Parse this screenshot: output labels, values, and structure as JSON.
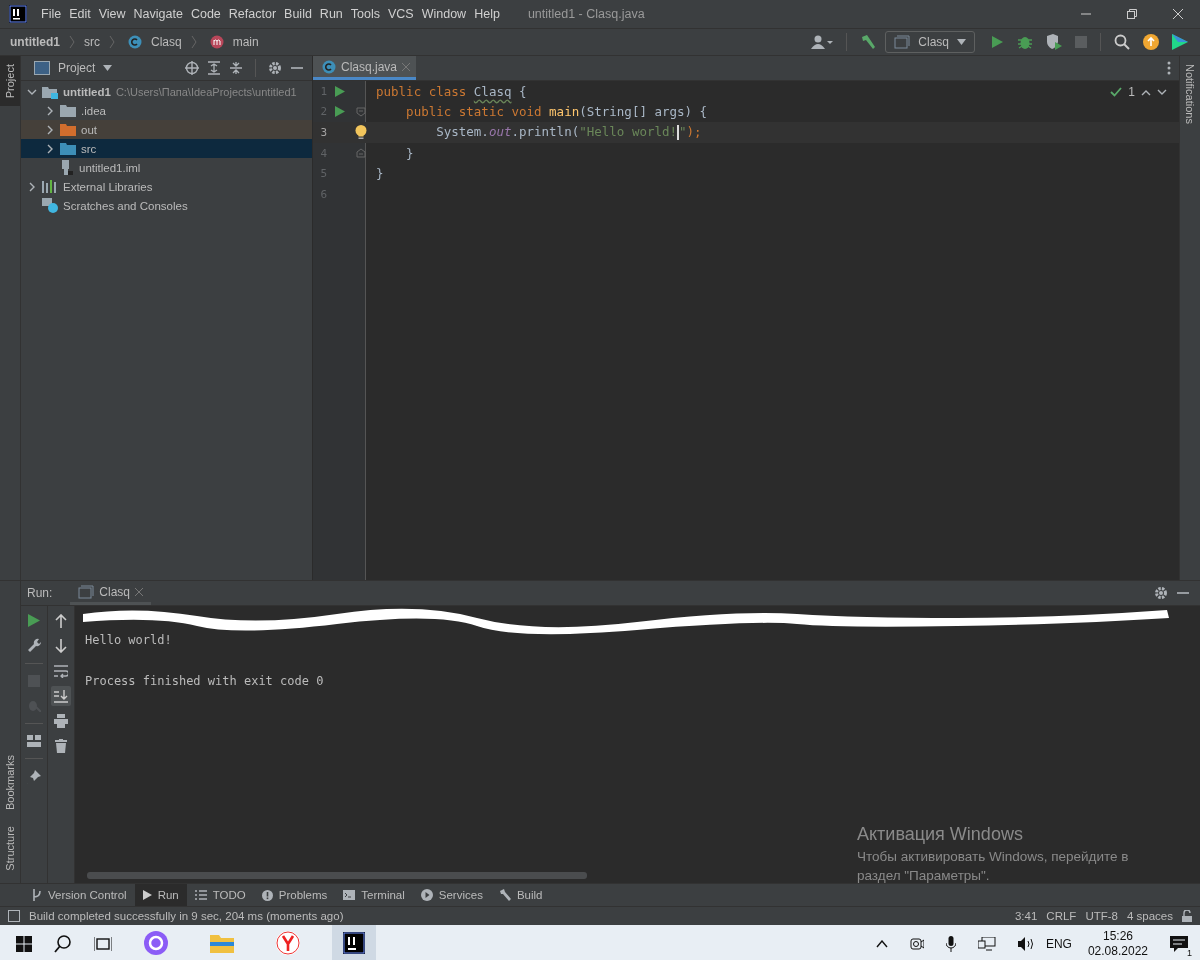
{
  "window": {
    "title": "untitled1 - Clasq.java"
  },
  "menu": [
    "File",
    "Edit",
    "View",
    "Navigate",
    "Code",
    "Refactor",
    "Build",
    "Run",
    "Tools",
    "VCS",
    "Window",
    "Help"
  ],
  "breadcrumbs": [
    {
      "label": "untitled1",
      "kind": "project"
    },
    {
      "label": "src",
      "kind": "folder"
    },
    {
      "label": "Clasq",
      "kind": "class"
    },
    {
      "label": "main",
      "kind": "method"
    }
  ],
  "run_config": {
    "label": "Clasq"
  },
  "left_strip_top": [
    {
      "label": "Project",
      "selected": true
    }
  ],
  "left_strip_bottom": [
    {
      "label": "Bookmarks",
      "selected": false
    },
    {
      "label": "Structure",
      "selected": false
    }
  ],
  "right_strip": [
    {
      "label": "Notifications",
      "selected": false
    }
  ],
  "project_panel": {
    "title": "Project",
    "tree": [
      {
        "label": "untitled1",
        "detail": "C:\\Users\\Папа\\IdeaProjects\\untitled1",
        "kind": "module",
        "expanded": true,
        "selected": false,
        "children": [
          {
            "label": ".idea",
            "kind": "folder",
            "expanded": false,
            "selected": false
          },
          {
            "label": "out",
            "kind": "excluded",
            "expanded": false,
            "selected": false
          },
          {
            "label": "src",
            "kind": "source",
            "expanded": false,
            "selected": true
          },
          {
            "label": "untitled1.iml",
            "kind": "file",
            "selected": false
          }
        ]
      },
      {
        "label": "External Libraries",
        "kind": "libraries",
        "expanded": false,
        "selected": false
      },
      {
        "label": "Scratches and Consoles",
        "kind": "scratches",
        "selected": false
      }
    ]
  },
  "editor": {
    "tabs": [
      {
        "label": "Clasq.java",
        "selected": true
      }
    ],
    "inspection": {
      "count": "1"
    },
    "lines": [
      {
        "number": "1",
        "current": false,
        "run_marker": true,
        "fold_start": false,
        "fold_end": false,
        "bulb": false,
        "tokens": [
          {
            "text": "public class ",
            "kind": "keyword",
            "caret_after": false
          },
          {
            "text": "Clasq",
            "kind": "typo",
            "caret_after": false
          },
          {
            "text": " {",
            "kind": "plain",
            "caret_after": false
          }
        ]
      },
      {
        "number": "2",
        "current": false,
        "run_marker": true,
        "fold_start": true,
        "fold_end": false,
        "bulb": false,
        "tokens": [
          {
            "text": "    public static void ",
            "kind": "keyword",
            "caret_after": false
          },
          {
            "text": "main",
            "kind": "decl",
            "caret_after": false
          },
          {
            "text": "(String[] args) {",
            "kind": "plain",
            "caret_after": false
          }
        ]
      },
      {
        "number": "3",
        "current": true,
        "run_marker": false,
        "fold_start": false,
        "fold_end": false,
        "bulb": true,
        "tokens": [
          {
            "text": "        System.",
            "kind": "plain",
            "caret_after": false
          },
          {
            "text": "out",
            "kind": "field",
            "caret_after": false
          },
          {
            "text": ".println(",
            "kind": "plain",
            "caret_after": false
          },
          {
            "text": "\"Hello world!",
            "kind": "string",
            "caret_after": true
          },
          {
            "text": "\"",
            "kind": "string",
            "caret_after": false
          },
          {
            "text": ");",
            "kind": "keyword",
            "caret_after": false
          }
        ]
      },
      {
        "number": "4",
        "current": false,
        "run_marker": false,
        "fold_start": false,
        "fold_end": true,
        "bulb": false,
        "tokens": [
          {
            "text": "    }",
            "kind": "plain",
            "caret_after": false
          }
        ]
      },
      {
        "number": "5",
        "current": false,
        "run_marker": false,
        "fold_start": false,
        "fold_end": false,
        "bulb": false,
        "tokens": [
          {
            "text": "}",
            "kind": "plain",
            "caret_after": false
          }
        ]
      },
      {
        "number": "6",
        "current": false,
        "run_marker": false,
        "fold_start": false,
        "fold_end": false,
        "bulb": false
      }
    ]
  },
  "run_panel": {
    "label": "Run:",
    "tabs": [
      {
        "label": "Clasq",
        "selected": true
      }
    ],
    "first_line_scribbled": true,
    "output_blocks": [
      [
        "Hello world!"
      ],
      [
        "Process finished with exit code 0"
      ]
    ]
  },
  "tool_windows": [
    {
      "label": "Version Control",
      "kind": "vcs",
      "selected": false
    },
    {
      "label": "Run",
      "kind": "run",
      "selected": true
    },
    {
      "label": "TODO",
      "kind": "todo",
      "selected": false
    },
    {
      "label": "Problems",
      "kind": "problems",
      "selected": false
    },
    {
      "label": "Terminal",
      "kind": "terminal",
      "selected": false
    },
    {
      "label": "Services",
      "kind": "services",
      "selected": false
    },
    {
      "label": "Build",
      "kind": "build",
      "selected": false
    }
  ],
  "status_bar": {
    "message": "Build completed successfully in 9 sec, 204 ms (moments ago)",
    "items": [
      "3:41",
      "CRLF",
      "UTF-8",
      "4 spaces"
    ]
  },
  "activation": {
    "title": "Активация Windows",
    "text": "Чтобы активировать Windows, перейдите в раздел \"Параметры\"."
  },
  "taskbar": {
    "apps": [
      {
        "kind": "assistant",
        "selected": false
      },
      {
        "kind": "explorer",
        "selected": false
      },
      {
        "kind": "browser",
        "selected": false
      },
      {
        "kind": "ide",
        "selected": true
      }
    ],
    "language": "ENG",
    "time": "15:26",
    "date": "02.08.2022",
    "notifications": "1"
  }
}
